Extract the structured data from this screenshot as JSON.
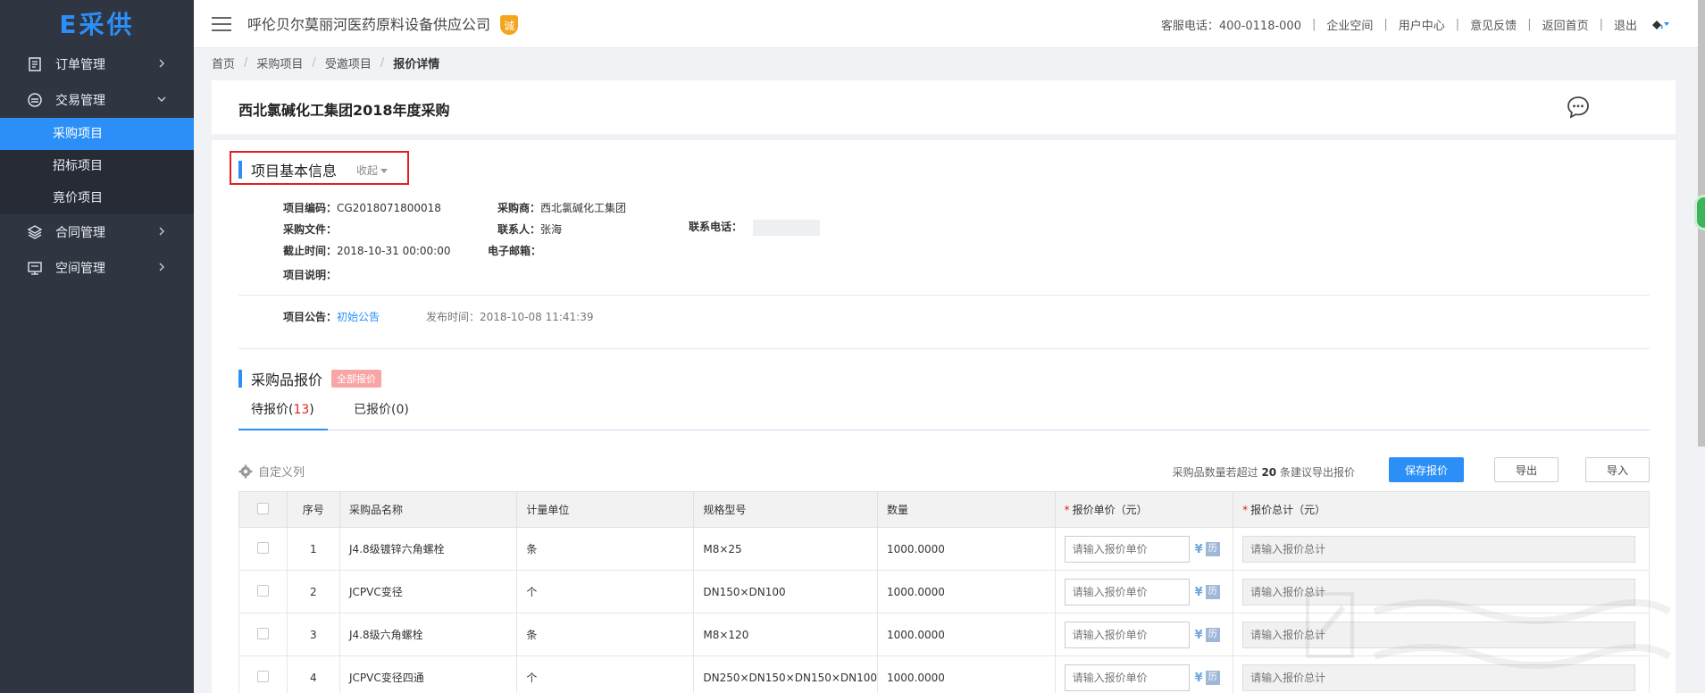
{
  "brand": {
    "logo_text": "E采供"
  },
  "sidebar": {
    "items": [
      {
        "label": "订单管理",
        "icon": "document-list-icon",
        "expanded": false
      },
      {
        "label": "交易管理",
        "icon": "minus-circle-icon",
        "expanded": true
      },
      {
        "label": "合同管理",
        "icon": "layers-icon",
        "expanded": false
      },
      {
        "label": "空间管理",
        "icon": "monitor-icon",
        "expanded": false
      }
    ],
    "subitems": [
      {
        "label": "采购项目",
        "active": true
      },
      {
        "label": "招标项目",
        "active": false
      },
      {
        "label": "竟价项目",
        "active": false
      }
    ]
  },
  "header": {
    "company": "呼伦贝尔莫丽河医药原料设备供应公司",
    "badge": "诚",
    "phone": "客服电话：400-0118-000",
    "links": [
      "企业空间",
      "用户中心",
      "意见反馈",
      "返回首页",
      "退出"
    ]
  },
  "breadcrumb": [
    "首页",
    "采购项目",
    "受邀项目",
    "报价详情"
  ],
  "page": {
    "title": "西北氯碱化工集团2018年度采购"
  },
  "basic_info": {
    "title": "项目基本信息",
    "collapse": "收起",
    "code_label": "项目编码：",
    "code_value": "CG2018071800018",
    "buyer_label": "采购商：",
    "buyer_value": "西北氯碱化工集团",
    "file_label": "采购文件：",
    "contact_label": "联系人：",
    "contact_value": "张海",
    "phone_label": "联系电话：",
    "deadline_label": "截止时间：",
    "deadline_value": "2018-10-31 00:00:00",
    "email_label": "电子邮箱：",
    "desc_label": "项目说明：",
    "notice_label": "项目公告：",
    "notice_link": "初始公告",
    "publish_label": "发布时间：",
    "publish_value": "2018-10-08 11:41:39"
  },
  "quote": {
    "title": "采购品报价",
    "tag": "全部报价",
    "tab_pending_prefix": "待报价(",
    "tab_pending_count": "13",
    "tab_pending_suffix": ")",
    "tab_done": "已报价(0)",
    "custom_columns": "自定义列",
    "hint_prefix": "采购品数量若超过",
    "hint_num": "20",
    "hint_suffix": "条建议导出报价",
    "save_btn": "保存报价",
    "export_btn": "导出",
    "import_btn": "导入",
    "columns": [
      "序号",
      "采购品名称",
      "计量单位",
      "规格型号",
      "数量",
      "报价单价（元）",
      "报价总计（元）"
    ],
    "price_placeholder": "请输入报价单价",
    "total_placeholder": "请输入报价总计",
    "yen": "¥",
    "hist": "历",
    "rows": [
      {
        "no": "1",
        "name": "J4.8级镀锌六角螺栓",
        "unit": "条",
        "spec": "M8×25",
        "qty": "1000.0000"
      },
      {
        "no": "2",
        "name": "JCPVC变径",
        "unit": "个",
        "spec": "DN150×DN100",
        "qty": "1000.0000"
      },
      {
        "no": "3",
        "name": "J4.8级六角螺栓",
        "unit": "条",
        "spec": "M8×120",
        "qty": "1000.0000"
      },
      {
        "no": "4",
        "name": "JCPVC变径四通",
        "unit": "个",
        "spec": "DN250×DN150×DN150×DN100",
        "qty": "1000.0000"
      }
    ]
  },
  "colors": {
    "primary": "#2b8ff7",
    "sidebar_bg": "#2f3541",
    "highlight_box": "#e02020",
    "tag_bg": "#f8a5a5"
  }
}
